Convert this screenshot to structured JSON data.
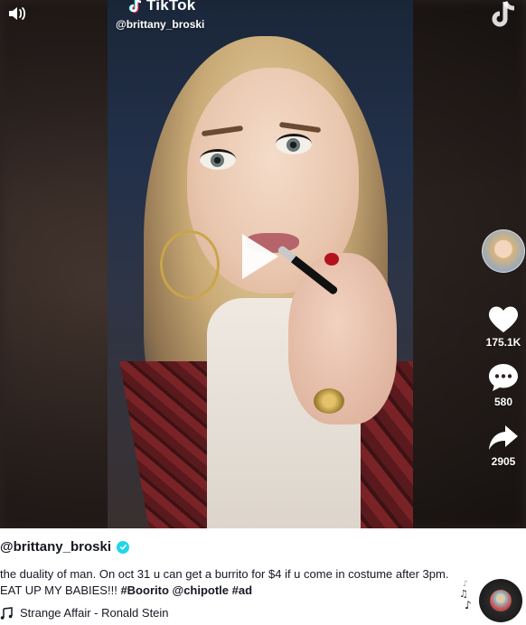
{
  "brand": {
    "name": "TikTok"
  },
  "video": {
    "overlay_handle": "@brittany_broski"
  },
  "rail": {
    "likes": "175.1K",
    "comments": "580",
    "shares": "2905"
  },
  "post": {
    "author": "@brittany_broski",
    "caption_text": "the duality of man. On oct 31 u can get a burrito for $4 if u come in costume after 3pm. EAT UP MY BABIES!!!",
    "hashtags": [
      "#Boorito",
      "@chipotle",
      "#ad"
    ],
    "sound": "Strange Affair - Ronald Stein"
  },
  "icons": {
    "volume": "volume-icon",
    "play": "play-icon",
    "like": "heart-icon",
    "comment": "comment-icon",
    "share": "share-icon",
    "verified": "verified-icon",
    "music": "music-note-icon"
  },
  "colors": {
    "text": "#161823",
    "verified": "#20d5ec",
    "rail_icon": "#ffffff"
  }
}
